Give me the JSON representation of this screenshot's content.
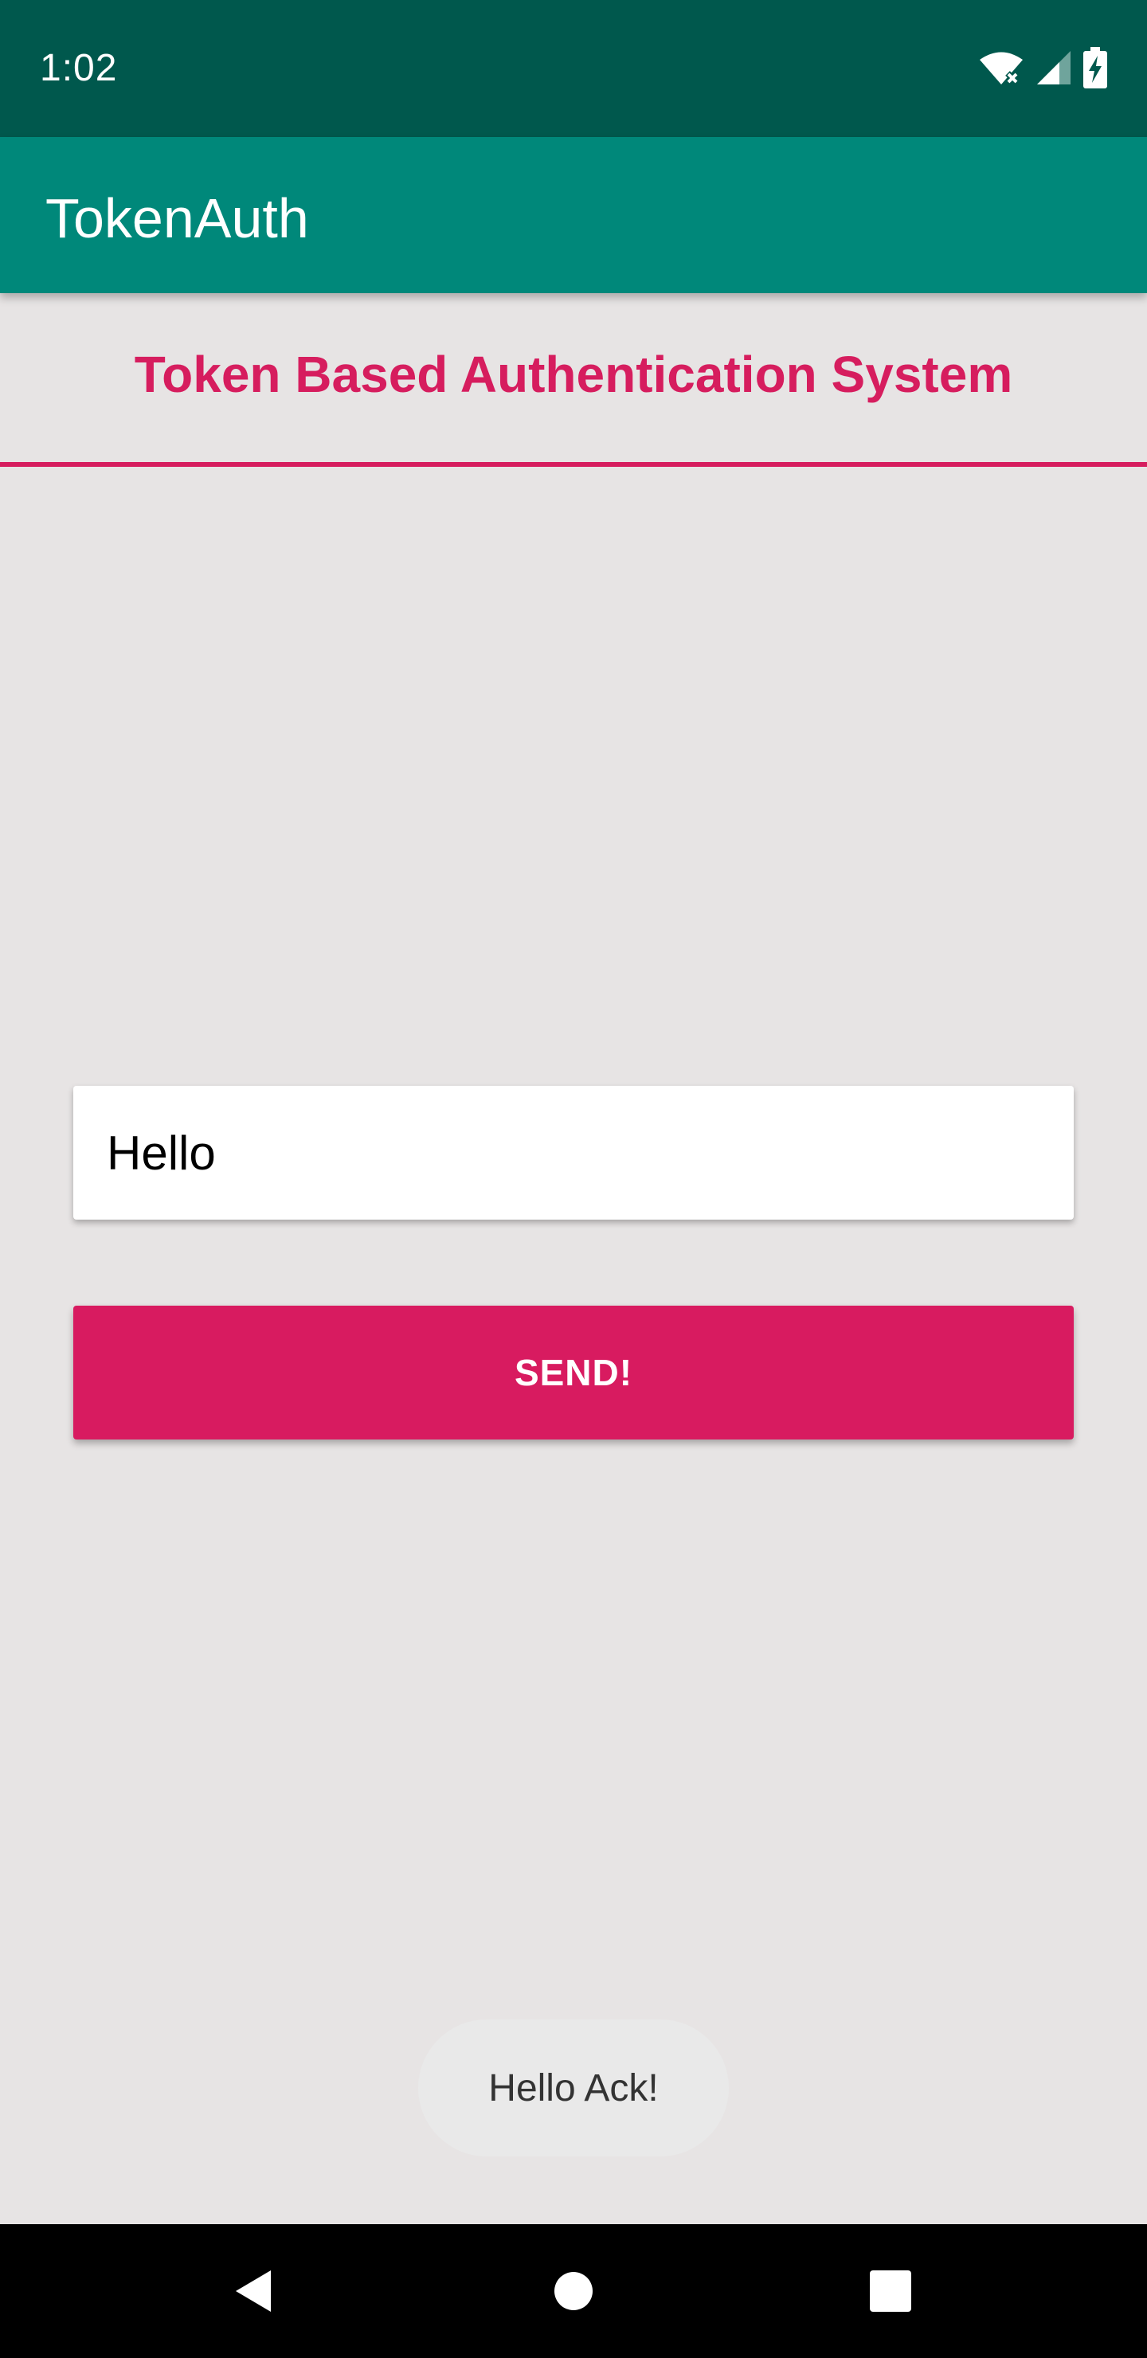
{
  "status_bar": {
    "time": "1:02",
    "icons": [
      "wifi-off-icon",
      "cellular-signal-icon",
      "battery-charging-icon"
    ]
  },
  "app_bar": {
    "title": "TokenAuth"
  },
  "header": {
    "title": "Token Based Authentication System"
  },
  "form": {
    "message_value": "Hello",
    "send_label": "SEND!"
  },
  "toast": {
    "text": "Hello Ack!"
  },
  "nav_bar": {
    "buttons": [
      "back-icon",
      "home-icon",
      "recents-icon"
    ]
  },
  "colors": {
    "status_bar": "#00584D",
    "app_bar": "#00887A",
    "accent": "#D81B60",
    "background": "#E7E4E4"
  }
}
